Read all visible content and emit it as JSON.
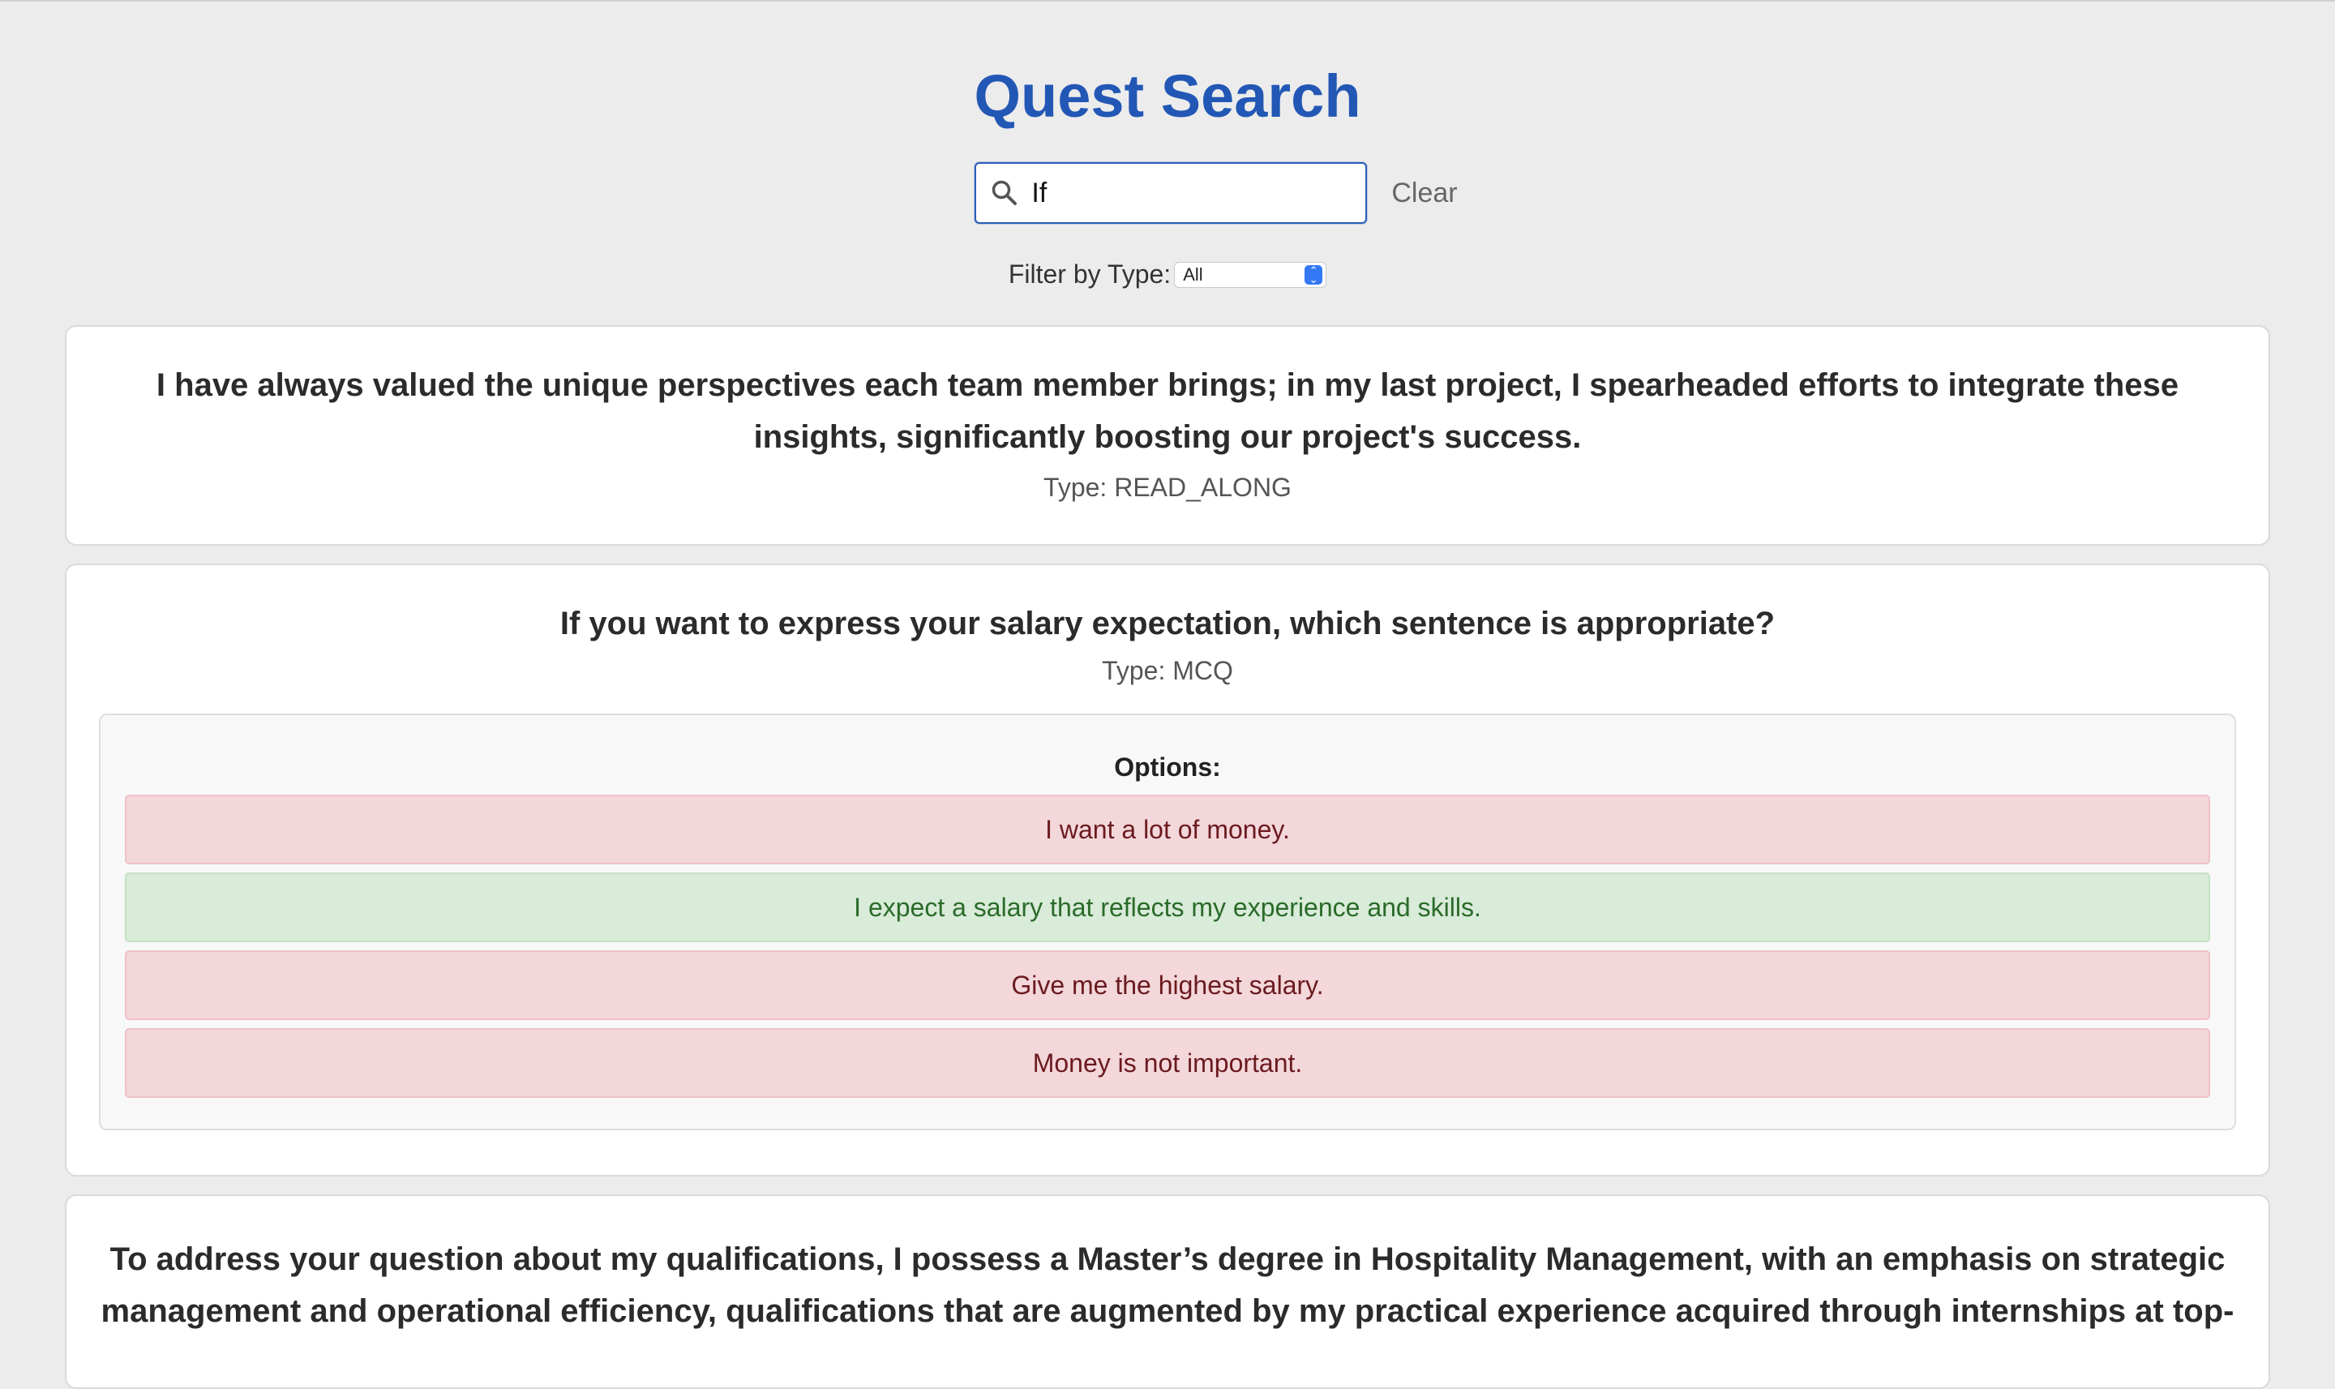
{
  "page": {
    "title": "Quest Search"
  },
  "search": {
    "value": "If",
    "clear_label": "Clear"
  },
  "filter": {
    "label": "Filter by Type:",
    "selected": "All"
  },
  "results": [
    {
      "question": "I have always valued the unique perspectives each team member brings; in my last project, I spearheaded efforts to integrate these insights, significantly boosting our project's success.",
      "type_label": "Type: READ_ALONG"
    },
    {
      "question": "If you want to express your salary expectation, which sentence is appropriate?",
      "type_label": "Type: MCQ",
      "options_title": "Options:",
      "options": [
        {
          "text": "I want a lot of money.",
          "correct": false
        },
        {
          "text": "I expect a salary that reflects my experience and skills.",
          "correct": true
        },
        {
          "text": "Give me the highest salary.",
          "correct": false
        },
        {
          "text": "Money is not important.",
          "correct": false
        }
      ]
    },
    {
      "question": "To address your question about my qualifications, I possess a Master’s degree in Hospitality Management, with an emphasis on strategic management and operational efficiency, qualifications that are augmented by my practical experience acquired through internships at top-"
    }
  ],
  "colors": {
    "accent": "#2257b5",
    "correct_bg": "#d9ebd9",
    "wrong_bg": "#f3d7da",
    "page_bg": "#ececec"
  },
  "icons": {
    "search": "search-icon",
    "select_arrows": "chevron-updown-icon"
  }
}
